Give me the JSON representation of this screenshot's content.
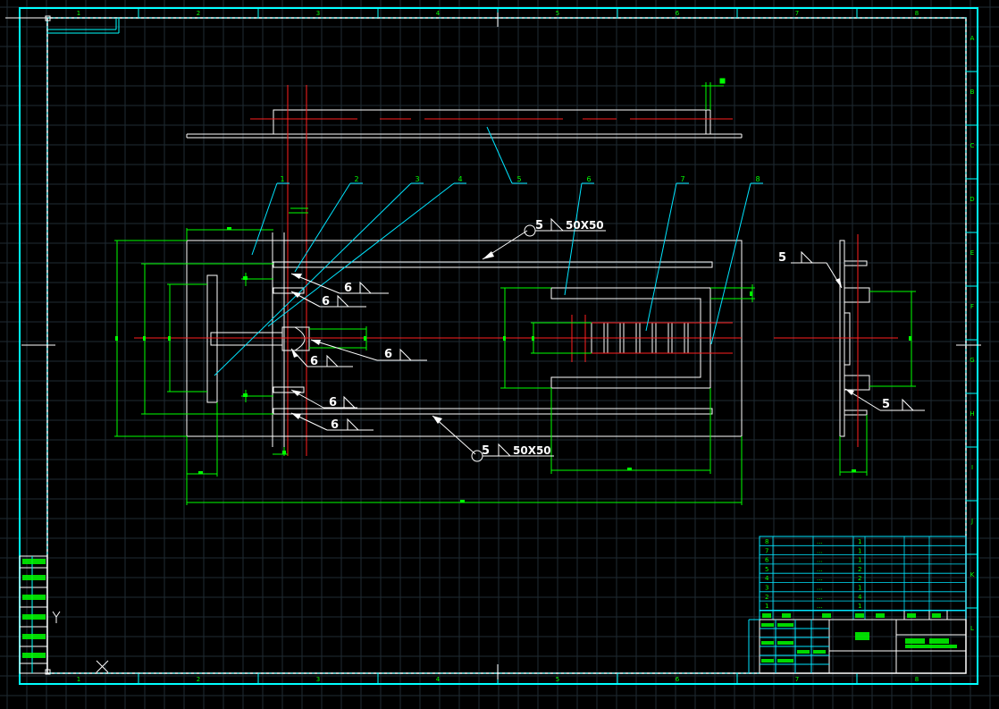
{
  "colors": {
    "background": "#000000",
    "grid": "#1f2b33",
    "frame_cyan": "#00ffff",
    "frame_white": "#ffffff",
    "dimension_green": "#00ff00",
    "centerline_red": "#ff2020",
    "leader_cyan": "#00e5ff",
    "weld_white": "#ffffff"
  },
  "border_zones_top": [
    "1",
    "2",
    "3",
    "4",
    "5",
    "6",
    "7",
    "8"
  ],
  "border_zones_right": [
    "A",
    "B",
    "C",
    "D",
    "E",
    "F",
    "G",
    "H",
    "I",
    "J",
    "K",
    "L"
  ],
  "balloons": [
    "1",
    "2",
    "3",
    "4",
    "5",
    "6",
    "7",
    "8"
  ],
  "weld_symbols": {
    "top_fillet": {
      "leg": "5",
      "size": "50X50"
    },
    "bottom_fillet": {
      "leg": "5",
      "size": "50X50"
    },
    "six": "6",
    "five": "5"
  },
  "bom": {
    "rows": [
      {
        "no": "8",
        "name": "...",
        "qty": "1"
      },
      {
        "no": "7",
        "name": "...",
        "qty": "1"
      },
      {
        "no": "6",
        "name": "...",
        "qty": "1"
      },
      {
        "no": "5",
        "name": "...",
        "qty": "2"
      },
      {
        "no": "4",
        "name": "...",
        "qty": "2"
      },
      {
        "no": "3",
        "name": "...",
        "qty": "1"
      },
      {
        "no": "2",
        "name": "...",
        "qty": "4"
      },
      {
        "no": "1",
        "name": "...",
        "qty": "1"
      }
    ]
  },
  "icons": [
    "ucs-y-axis-icon",
    "ucs-x-cross-icon"
  ]
}
